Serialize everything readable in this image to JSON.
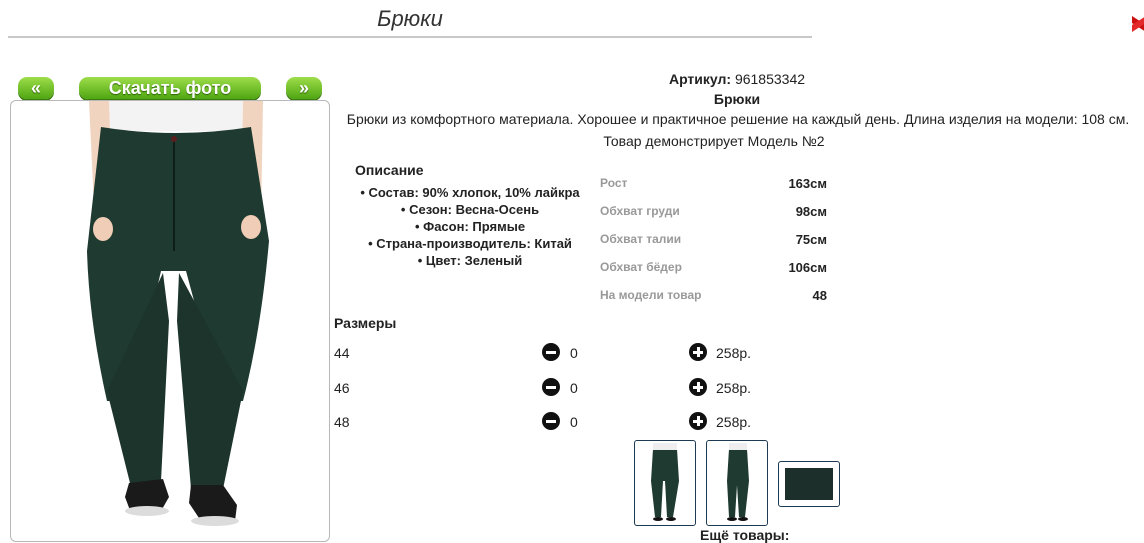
{
  "page": {
    "title": "Брюки",
    "close_icon": "close-x-icon",
    "accent_red": "#cc1111"
  },
  "gallery": {
    "prev_label": "«",
    "next_label": "»",
    "download_label": "Скачать фото",
    "button_color": "#5bb41a"
  },
  "product": {
    "article_label": "Артикул:",
    "article_value": "961853342",
    "name": "Брюки",
    "description": "Брюки из комфортного материала. Хорошее и практичное решение на каждый день. Длина изделия на модели: 108 см.",
    "model_note": "Товар демонстрирует Модель №2",
    "pants_color": "#1f3a30"
  },
  "details": {
    "heading": "Описание",
    "items": [
      "Состав: 90% хлопок, 10% лайкра",
      "Сезон: Весна-Осень",
      "Фасон: Прямые",
      "Страна-производитель: Китай",
      "Цвет: Зеленый"
    ]
  },
  "model_params": [
    {
      "label": "Рост",
      "value": "163см"
    },
    {
      "label": "Обхват груди",
      "value": "98см"
    },
    {
      "label": "Обхват талии",
      "value": "75см"
    },
    {
      "label": "Обхват бёдер",
      "value": "106см"
    },
    {
      "label": "На модели товар",
      "value": "48"
    }
  ],
  "sizes": {
    "heading": "Размеры",
    "minus_icon": "minus-circle-icon",
    "plus_icon": "plus-circle-icon",
    "rows": [
      {
        "size": "44",
        "qty": "0",
        "price": "258р."
      },
      {
        "size": "46",
        "qty": "0",
        "price": "258р."
      },
      {
        "size": "48",
        "qty": "0",
        "price": "258р."
      }
    ]
  },
  "more": {
    "label": "Ещё товары:"
  }
}
